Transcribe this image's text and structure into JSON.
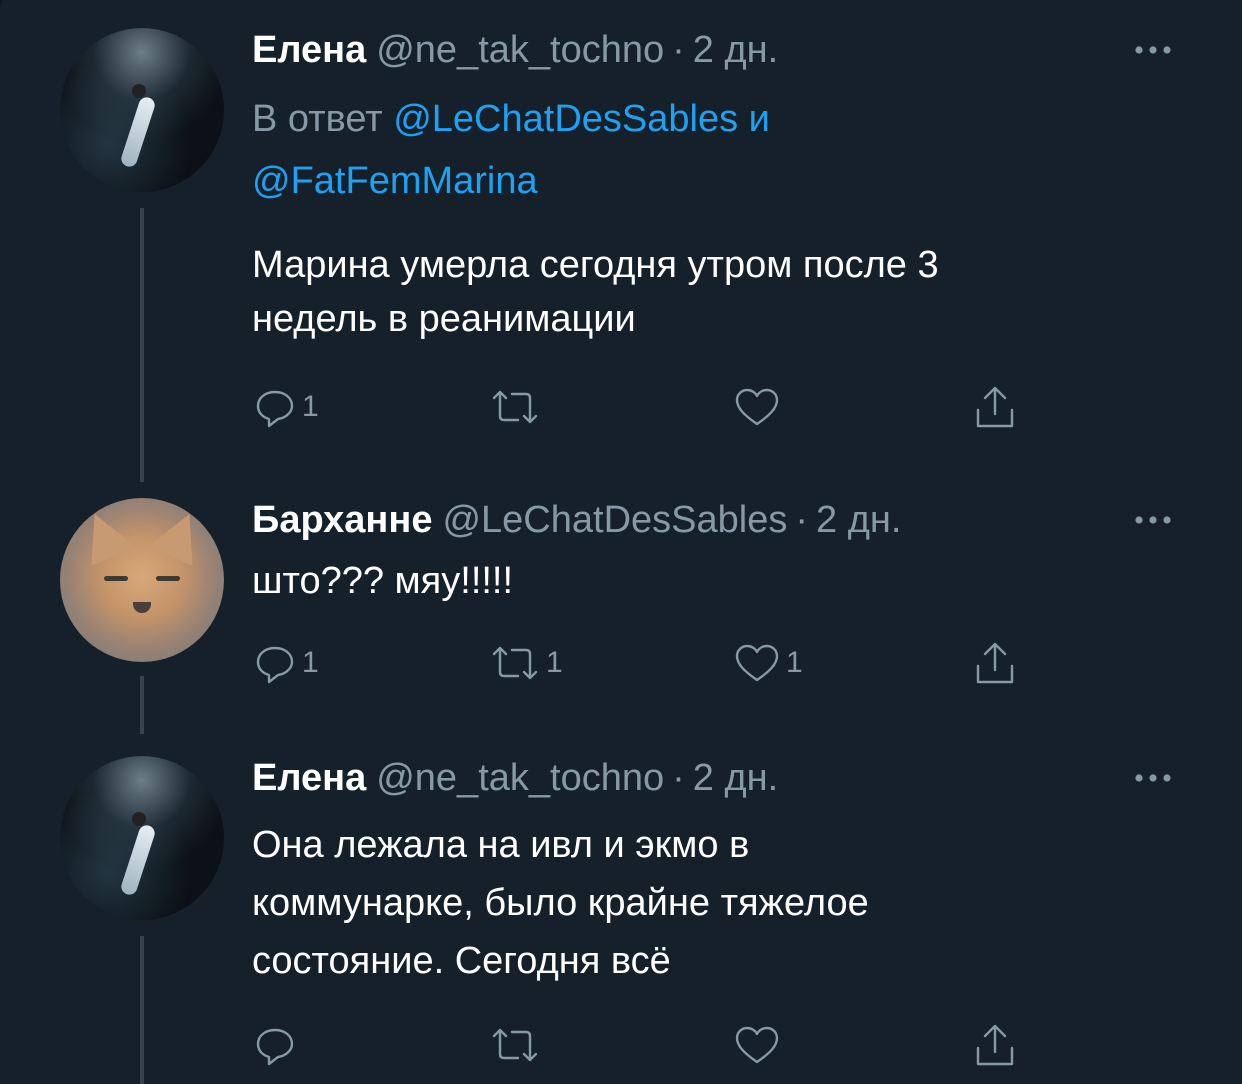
{
  "tweets": [
    {
      "name": "Елена",
      "handle": "@ne_tak_tochno",
      "sep": "·",
      "time": "2 дн.",
      "avatar_icon": "diver-avatar",
      "reply": {
        "prefix": "В ответ",
        "mention1": "@LeChatDesSables",
        "joiner": "и",
        "mention2": "@FatFemMarina"
      },
      "text_lines": [
        "Марина умерла сегодня утром после 3",
        "недель в реанимации"
      ],
      "actions": {
        "reply_count": "1",
        "retweet_count": "",
        "like_count": ""
      }
    },
    {
      "name": "Барханне",
      "handle": "@LeChatDesSables",
      "sep": "·",
      "time": "2 дн.",
      "avatar_icon": "sand-cat-avatar",
      "text_lines": [
        "што??? мяу!!!!!"
      ],
      "actions": {
        "reply_count": "1",
        "retweet_count": "1",
        "like_count": "1"
      }
    },
    {
      "name": "Елена",
      "handle": "@ne_tak_tochno",
      "sep": "·",
      "time": "2 дн.",
      "avatar_icon": "diver-avatar",
      "text_lines": [
        "Она лежала на ивл и экмо в",
        "коммунарке, было крайне тяжелое",
        "состояние. Сегодня всё"
      ],
      "actions": {
        "reply_count": "",
        "retweet_count": "",
        "like_count": ""
      }
    }
  ],
  "colors": {
    "background": "#15202b",
    "text": "#ffffff",
    "secondary": "#8899a6",
    "accent": "#1da1f2",
    "thread_line": "#38444d"
  },
  "icons": [
    "reply-icon",
    "retweet-icon",
    "like-icon",
    "share-icon",
    "more-icon"
  ]
}
